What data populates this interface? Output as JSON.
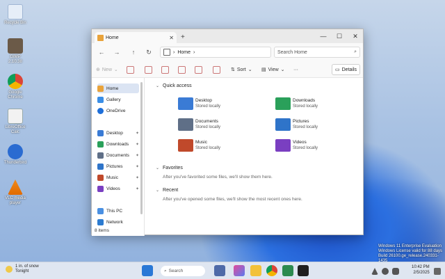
{
  "desktop": {
    "icons": [
      {
        "label": "Recycle Bin",
        "icon": "recycle-bin-icon"
      },
      {
        "label": "GIMP 2.10.38",
        "icon": "gimp-icon"
      },
      {
        "label": "Google Chrome",
        "icon": "chrome-icon"
      },
      {
        "label": "LibreOffice Calc",
        "icon": "libreoffice-calc-icon"
      },
      {
        "label": "Thunderbird",
        "icon": "thunderbird-icon"
      },
      {
        "label": "VLC media player",
        "icon": "vlc-icon"
      }
    ]
  },
  "explorer": {
    "tab_title": "Home",
    "tab_close": "✕",
    "new_tab": "+",
    "window_controls": {
      "minimize": "—",
      "maximize": "☐",
      "close": "✕"
    },
    "nav": {
      "back": "←",
      "forward": "→",
      "up": "↑",
      "refresh": "↻"
    },
    "address": {
      "separator": "›",
      "location": "Home",
      "chevron": "›"
    },
    "search": {
      "placeholder": "Search Home",
      "icon": "search-icon"
    },
    "toolbar": {
      "new_label": "New",
      "sort_label": "Sort",
      "view_label": "View",
      "more_label": "···",
      "details_label": "Details"
    },
    "sidebar": {
      "items": [
        {
          "label": "Home",
          "icon": "home-icon"
        },
        {
          "label": "Gallery",
          "icon": "gallery-icon"
        },
        {
          "label": "OneDrive",
          "icon": "onedrive-icon"
        },
        {
          "label": "Desktop",
          "icon": "desktop-folder-icon",
          "pinned": true
        },
        {
          "label": "Downloads",
          "icon": "downloads-folder-icon",
          "pinned": true
        },
        {
          "label": "Documents",
          "icon": "documents-folder-icon",
          "pinned": true
        },
        {
          "label": "Pictures",
          "icon": "pictures-folder-icon",
          "pinned": true
        },
        {
          "label": "Music",
          "icon": "music-folder-icon",
          "pinned": true
        },
        {
          "label": "Videos",
          "icon": "videos-folder-icon",
          "pinned": true
        },
        {
          "label": "This PC",
          "icon": "this-pc-icon"
        },
        {
          "label": "Network",
          "icon": "network-icon"
        }
      ],
      "pin_glyph": "📌"
    },
    "status": {
      "item_count": "8 items"
    },
    "quick_access": {
      "heading": "Quick access",
      "folders": [
        {
          "name": "Desktop",
          "sub": "Stored locally",
          "color": "#3a7bd5"
        },
        {
          "name": "Downloads",
          "sub": "Stored locally",
          "color": "#2aa05a"
        },
        {
          "name": "Documents",
          "sub": "Stored locally",
          "color": "#5f6f87"
        },
        {
          "name": "Pictures",
          "sub": "Stored locally",
          "color": "#2f74c9"
        },
        {
          "name": "Music",
          "sub": "Stored locally",
          "color": "#c0492b"
        },
        {
          "name": "Videos",
          "sub": "Stored locally",
          "color": "#7a3fc1"
        }
      ]
    },
    "favorites": {
      "heading": "Favorites",
      "hint_text": "After you've favorited some files, we'll",
      "hint_link": "show them here."
    },
    "recent": {
      "heading": "Recent",
      "hint_text": "After you've opened some files, we'll",
      "hint_link": "show the most recent ones here."
    }
  },
  "taskbar": {
    "weather": {
      "temp": "1 in. of snow",
      "sub": "Tonight"
    },
    "search_placeholder": "Search",
    "clock": {
      "time": "10:42 PM",
      "date": "2/5/2025"
    },
    "watermark": [
      "Windows 11 Enterprise Evaluation",
      "Windows License valid for 88 days",
      "Build 26100.ge_release.240331-1435"
    ]
  }
}
